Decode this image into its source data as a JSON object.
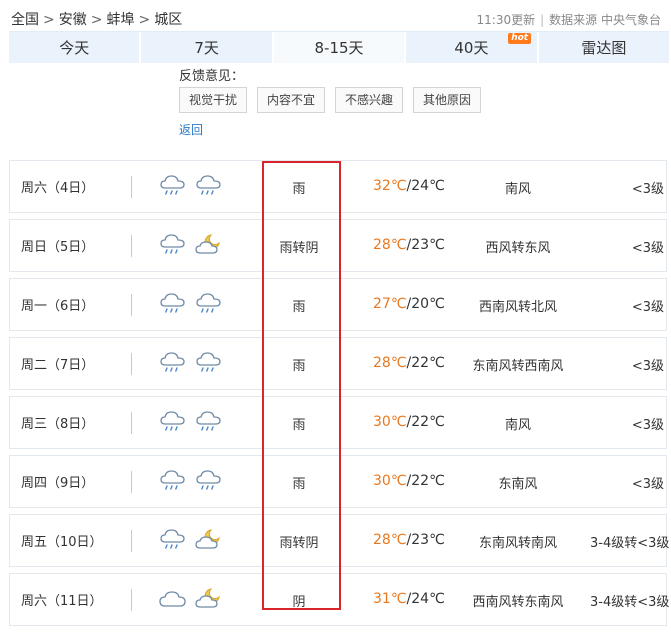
{
  "breadcrumb": [
    "全国",
    "安徽",
    "蚌埠",
    "城区"
  ],
  "header": {
    "update_time": "11:30更新",
    "source": "数据来源 中央气象台"
  },
  "tabs": [
    {
      "label": "今天"
    },
    {
      "label": "7天"
    },
    {
      "label": "8-15天",
      "active": true
    },
    {
      "label": "40天",
      "badge": "hot"
    },
    {
      "label": "雷达图"
    }
  ],
  "feedback": {
    "title": "反馈意见：",
    "options": [
      "视觉干扰",
      "内容不宜",
      "不感兴趣",
      "其他原因"
    ],
    "back": "返回"
  },
  "colors": {
    "accent_temp": "#e8781f",
    "highlight": "#d8262c",
    "tab_bg": "#eaf3fb",
    "link": "#2a78c8"
  },
  "forecast": [
    {
      "day": "周六（4日）",
      "icons": [
        "rain-cloud-icon",
        "rain-cloud-icon"
      ],
      "condition": "雨",
      "high": "32℃",
      "low": "24℃",
      "wind": "南风",
      "level": "<3级"
    },
    {
      "day": "周日（5日）",
      "icons": [
        "rain-cloud-icon",
        "partly-cloudy-moon-icon"
      ],
      "condition": "雨转阴",
      "high": "28℃",
      "low": "23℃",
      "wind": "西风转东风",
      "level": "<3级"
    },
    {
      "day": "周一（6日）",
      "icons": [
        "rain-cloud-icon",
        "rain-cloud-icon"
      ],
      "condition": "雨",
      "high": "27℃",
      "low": "20℃",
      "wind": "西南风转北风",
      "level": "<3级"
    },
    {
      "day": "周二（7日）",
      "icons": [
        "rain-cloud-icon",
        "rain-cloud-icon"
      ],
      "condition": "雨",
      "high": "28℃",
      "low": "22℃",
      "wind": "东南风转西南风",
      "level": "<3级"
    },
    {
      "day": "周三（8日）",
      "icons": [
        "rain-cloud-icon",
        "rain-cloud-icon"
      ],
      "condition": "雨",
      "high": "30℃",
      "low": "22℃",
      "wind": "南风",
      "level": "<3级"
    },
    {
      "day": "周四（9日）",
      "icons": [
        "rain-cloud-icon",
        "rain-cloud-icon"
      ],
      "condition": "雨",
      "high": "30℃",
      "low": "22℃",
      "wind": "东南风",
      "level": "<3级"
    },
    {
      "day": "周五（10日）",
      "icons": [
        "rain-cloud-icon",
        "partly-cloudy-moon-icon"
      ],
      "condition": "雨转阴",
      "high": "28℃",
      "low": "23℃",
      "wind": "东南风转南风",
      "level": "3-4级转<3级"
    },
    {
      "day": "周六（11日）",
      "icons": [
        "cloud-icon",
        "partly-cloudy-moon-icon"
      ],
      "condition": "阴",
      "high": "31℃",
      "low": "24℃",
      "wind": "西南风转东南风",
      "level": "3-4级转<3级"
    }
  ]
}
